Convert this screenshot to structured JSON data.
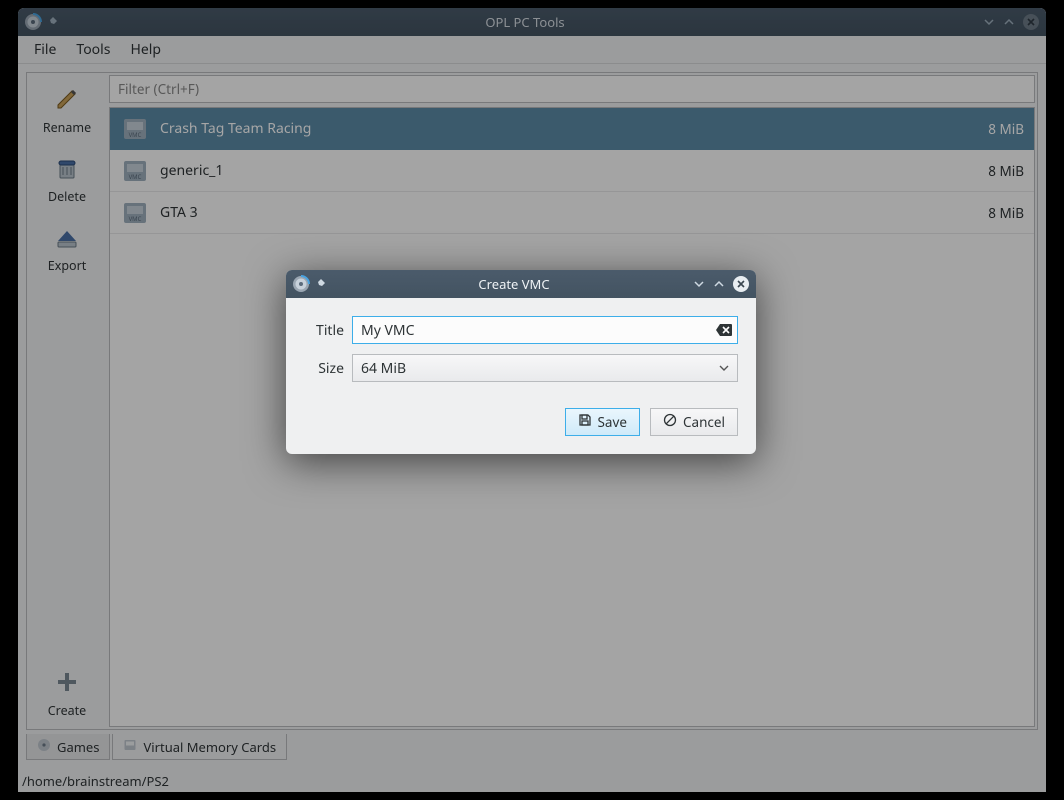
{
  "window": {
    "title": "OPL PC Tools"
  },
  "menubar": [
    "File",
    "Tools",
    "Help"
  ],
  "sidebar": {
    "rename": "Rename",
    "delete": "Delete",
    "export": "Export",
    "create": "Create"
  },
  "filter": {
    "placeholder": "Filter (Ctrl+F)",
    "value": ""
  },
  "list": {
    "rows": [
      {
        "name": "Crash Tag Team Racing",
        "size": "8 MiB",
        "selected": true
      },
      {
        "name": "generic_1",
        "size": "8 MiB",
        "selected": false
      },
      {
        "name": "GTA 3",
        "size": "8 MiB",
        "selected": false
      }
    ]
  },
  "tabs": {
    "games": "Games",
    "vmc": "Virtual Memory Cards"
  },
  "status": "/home/brainstream/PS2",
  "dialog": {
    "title": "Create VMC",
    "title_label": "Title",
    "title_value": "My VMC",
    "size_label": "Size",
    "size_value": "64 MiB",
    "save": "Save",
    "cancel": "Cancel"
  }
}
